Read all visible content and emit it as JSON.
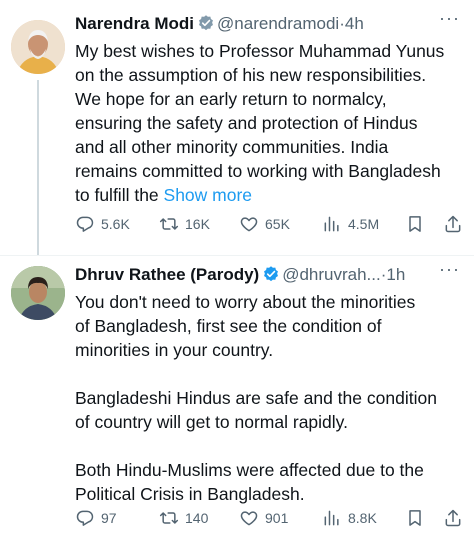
{
  "tweets": [
    {
      "name": "Narendra Modi",
      "handle": "@narendramodi",
      "time": "4h",
      "text": "My best wishes to Professor Muhammad Yunus\non the assumption of his new responsibilities.\nWe hope for an early return to normalcy,\nensuring the safety and protection of Hindus\nand all other minority communities. India\nremains committed to working with Bangladesh\nto fulfill the ",
      "show_more": "Show more",
      "stats": {
        "replies": "5.6K",
        "reposts": "16K",
        "likes": "65K",
        "views": "4.5M"
      }
    },
    {
      "name": "Dhruv Rathee (Parody)",
      "handle": "@dhruvrah...",
      "time": "1h",
      "text": "You don't need to worry about the minorities\nof Bangladesh, first see the condition of\nminorities in your country.\n\nBangladeshi Hindus are safe and the condition\nof country will get to normal rapidly.\n\nBoth Hindu-Muslims were affected due to the\nPolitical Crisis in Bangladesh.",
      "stats": {
        "replies": "97",
        "reposts": "140",
        "likes": "901",
        "views": "8.8K"
      }
    }
  ],
  "separator_dot": "·",
  "more_glyph": "···",
  "colors": {
    "accent": "#1d9bf0",
    "muted": "#536471",
    "text": "#0f1419",
    "thread_line": "#cfd9de"
  },
  "icons": [
    "verified-badge-icon",
    "reply-icon",
    "repost-icon",
    "like-icon",
    "views-icon",
    "bookmark-icon",
    "share-icon",
    "more-icon"
  ]
}
